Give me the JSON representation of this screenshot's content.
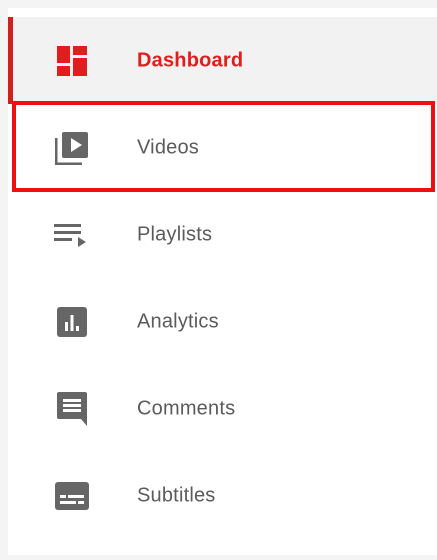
{
  "sidebar": {
    "items": [
      {
        "label": "Dashboard",
        "icon": "dashboard-icon",
        "active": true
      },
      {
        "label": "Videos",
        "icon": "video-library-icon",
        "active": false,
        "highlighted": true
      },
      {
        "label": "Playlists",
        "icon": "playlist-icon",
        "active": false
      },
      {
        "label": "Analytics",
        "icon": "analytics-icon",
        "active": false
      },
      {
        "label": "Comments",
        "icon": "comments-icon",
        "active": false
      },
      {
        "label": "Subtitles",
        "icon": "subtitles-icon",
        "active": false
      }
    ]
  },
  "colors": {
    "accent": "#e11d1d",
    "highlight_border": "#ee1010",
    "text": "#5b5b5b",
    "icon": "#666666",
    "active_background": "#f2f2f2"
  }
}
